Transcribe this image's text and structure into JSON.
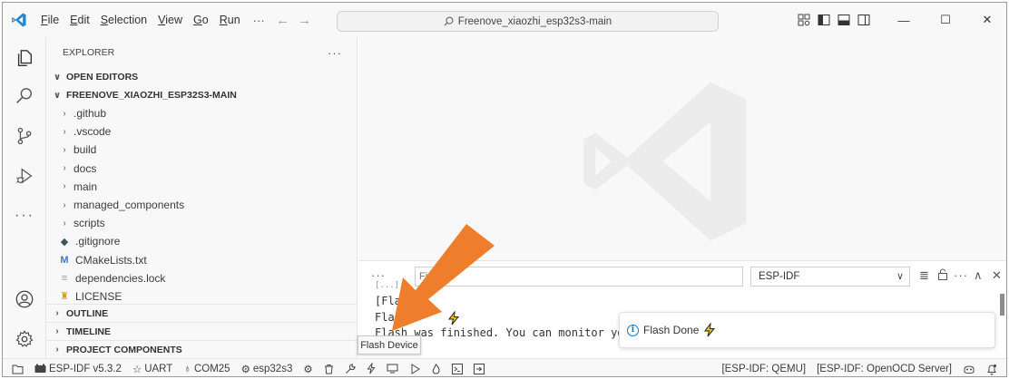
{
  "titlebar": {
    "menu": [
      {
        "label": "File",
        "mnemonic": "F",
        "rest": "ile"
      },
      {
        "label": "Edit",
        "mnemonic": "E",
        "rest": "dit"
      },
      {
        "label": "Selection",
        "mnemonic": "S",
        "rest": "election"
      },
      {
        "label": "View",
        "mnemonic": "V",
        "rest": "iew"
      },
      {
        "label": "Go",
        "mnemonic": "G",
        "rest": "o"
      },
      {
        "label": "Run",
        "mnemonic": "R",
        "rest": "un"
      }
    ],
    "more": "···",
    "back_arrow": "←",
    "forward_arrow": "→",
    "search_text": "Freenove_xiaozhi_esp32s3-main",
    "minimize": "—",
    "maximize": "☐",
    "close": "✕"
  },
  "sidebar": {
    "title": "EXPLORER",
    "more": "···",
    "open_editors": "OPEN EDITORS",
    "folder": "FREENOVE_XIAOZHI_ESP32S3-MAIN",
    "items": [
      {
        "label": ".github",
        "kind": "folder"
      },
      {
        "label": ".vscode",
        "kind": "folder"
      },
      {
        "label": "build",
        "kind": "folder"
      },
      {
        "label": "docs",
        "kind": "folder"
      },
      {
        "label": "main",
        "kind": "folder"
      },
      {
        "label": "managed_components",
        "kind": "folder"
      },
      {
        "label": "scripts",
        "kind": "folder"
      },
      {
        "label": ".gitignore",
        "kind": "file",
        "icon": "◆"
      },
      {
        "label": "CMakeLists.txt",
        "kind": "file",
        "icon": "M"
      },
      {
        "label": "dependencies.lock",
        "kind": "file",
        "icon": "≡"
      },
      {
        "label": "LICENSE",
        "kind": "file",
        "icon": "♜"
      }
    ],
    "outline": "OUTLINE",
    "timeline": "TIMELINE",
    "project_components": "PROJECT COMPONENTS"
  },
  "panel": {
    "more": "···",
    "filter_placeholder": "Fi",
    "channel": "ESP-IDF",
    "output_lines": [
      "[Fla",
      "Flas",
      "Flash was finished. You can monitor yo"
    ],
    "output_partial_top": "[...]"
  },
  "toast": {
    "message": "Flash Done"
  },
  "tooltip": {
    "text": "Flash Device"
  },
  "statusbar": {
    "idf_version": "ESP-IDF v5.3.2",
    "flash_method": "UART",
    "port": "COM25",
    "target": "esp32s3",
    "qemu": "[ESP-IDF: QEMU]",
    "openocd": "[ESP-IDF: OpenOCD Server]"
  },
  "colors": {
    "accent_blue": "#0078d4",
    "arrow_orange": "#ee7d2c",
    "lightning_yellow": "#f5c400"
  }
}
